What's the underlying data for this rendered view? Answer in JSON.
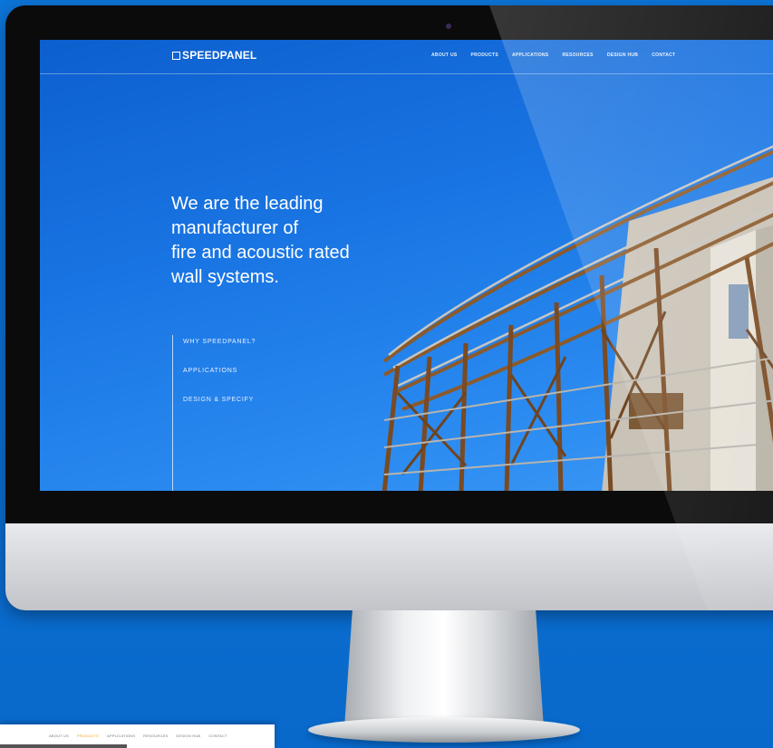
{
  "site": {
    "logo": "SPEEDPANEL",
    "nav": [
      "ABOUT US",
      "PRODUCTS",
      "APPLICATIONS",
      "RESOURCES",
      "DESIGN HUB",
      "CONTACT"
    ],
    "hero_lines": [
      "We are the leading",
      "manufacturer of",
      "fire and acoustic rated",
      "wall systems."
    ],
    "side_links": [
      "WHY SPEEDPANEL?",
      "APPLICATIONS",
      "DESIGN & SPECIFY"
    ]
  },
  "mini_site": {
    "nav": [
      "ABOUT US",
      "PRODUCTS",
      "APPLICATIONS",
      "RESOURCES",
      "DESIGN HUB",
      "CONTACT"
    ],
    "active_index": 1
  },
  "colors": {
    "background": "#0a6fd3",
    "accent": "#f0a020"
  }
}
